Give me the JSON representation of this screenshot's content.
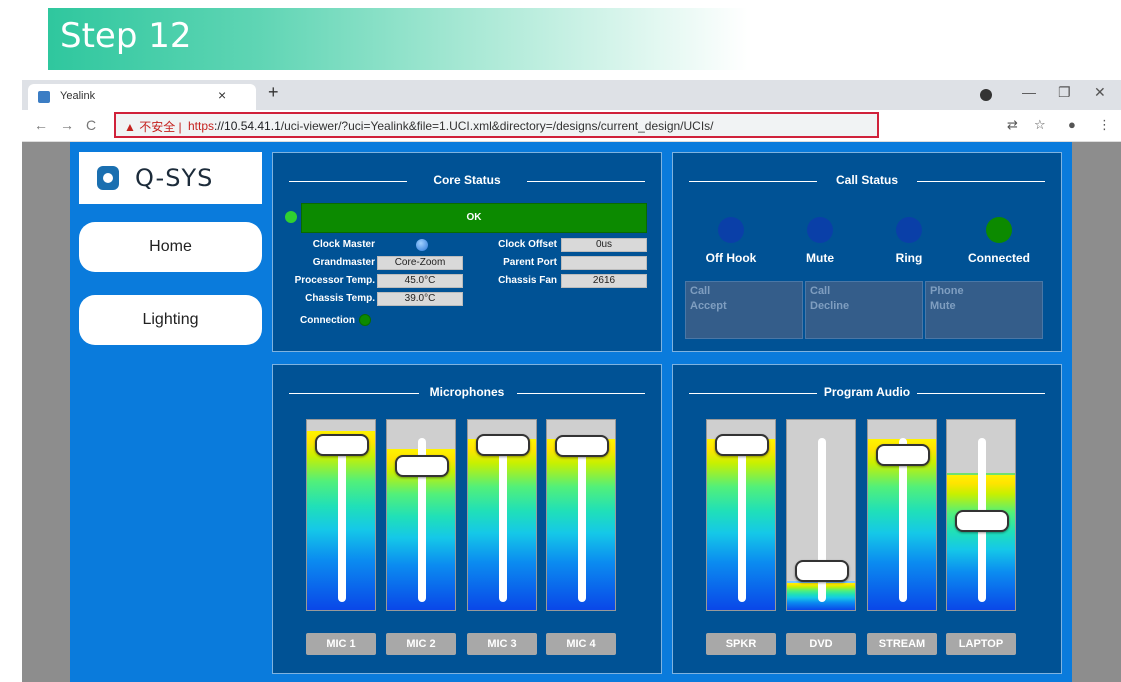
{
  "banner": {
    "title": "Step 12"
  },
  "browser": {
    "tab_title": "Yealink",
    "tab_close": "×",
    "new_tab": "+",
    "window_controls": {
      "minimize": "—",
      "restore": "❐",
      "close": "✕"
    },
    "nav": {
      "back": "←",
      "forward": "→",
      "reload": "C"
    },
    "security_warning": "▲ 不安全 |",
    "url_protocol": "https",
    "url_host": "://10.54.41.1",
    "url_rest": "/uci-viewer/?uci=Yealink&file=1.UCI.xml&directory=/designs/current_design/UCIs/",
    "right_icons": {
      "translate": "⇄",
      "bookmark": "☆",
      "account": "●",
      "menu": "⋮"
    }
  },
  "app": {
    "logo_text": "Q-SYS",
    "nav_buttons": [
      "Home",
      "Lighting"
    ]
  },
  "core_status": {
    "heading": "Core Status",
    "status_text": "OK",
    "clock_master_label": "Clock Master",
    "grandmaster_label": "Grandmaster",
    "grandmaster_value": "Core-Zoom",
    "processor_temp_label": "Processor Temp.",
    "processor_temp_value": "45.0°C",
    "chassis_temp_label": "Chassis Temp.",
    "chassis_temp_value": "39.0°C",
    "connection_label": "Connection",
    "clock_offset_label": "Clock Offset",
    "clock_offset_value": "0us",
    "parent_port_label": "Parent Port",
    "parent_port_value": "",
    "chassis_fan_label": "Chassis Fan",
    "chassis_fan_value": "2616"
  },
  "call_status": {
    "heading": "Call Status",
    "indicators": [
      "Off Hook",
      "Mute",
      "Ring",
      "Connected"
    ],
    "buttons": [
      {
        "line1": "Call",
        "line2": "Accept"
      },
      {
        "line1": "Call",
        "line2": "Decline"
      },
      {
        "line1": "Phone",
        "line2": "Mute"
      }
    ]
  },
  "microphones": {
    "heading": "Microphones",
    "channels": [
      {
        "label": "MIC 1",
        "level": 0.94,
        "gain": 0.93
      },
      {
        "label": "MIC 2",
        "level": 0.85,
        "gain": 0.8
      },
      {
        "label": "MIC 3",
        "level": 0.9,
        "gain": 0.93
      },
      {
        "label": "MIC 4",
        "level": 0.9,
        "gain": 0.92
      }
    ]
  },
  "program_audio": {
    "heading": "Program Audio",
    "channels": [
      {
        "label": "SPKR",
        "level": 0.9,
        "gain": 0.93
      },
      {
        "label": "DVD",
        "level": 0.14,
        "gain": 0.17
      },
      {
        "label": "STREAM",
        "level": 0.9,
        "gain": 0.87
      },
      {
        "label": "LAPTOP",
        "level": 0.71,
        "gain": 0.47
      }
    ]
  },
  "colors": {
    "app_blue": "#0a7bdc",
    "panel_blue": "#005295",
    "ok_green": "#0c8a00",
    "led_dark_blue": "#0a3fa8",
    "led_green": "#0c8a00"
  }
}
